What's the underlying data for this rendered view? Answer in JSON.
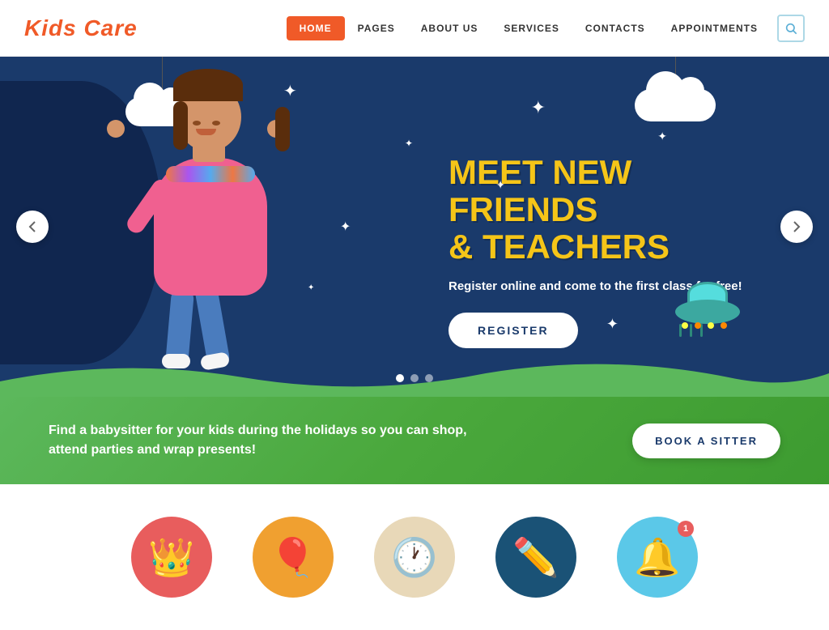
{
  "header": {
    "logo": "Kids Care",
    "nav": [
      {
        "label": "HOME",
        "active": true
      },
      {
        "label": "PAGES",
        "active": false
      },
      {
        "label": "ABOUT US",
        "active": false
      },
      {
        "label": "SERVICES",
        "active": false
      },
      {
        "label": "CONTACTS",
        "active": false
      },
      {
        "label": "APPOINTMENTS",
        "active": false
      }
    ],
    "search_icon": "🔍"
  },
  "hero": {
    "title_line1": "MEET NEW FRIENDS",
    "title_line2": "& TEACHERS",
    "subtitle": "Register online and come to the first class for free!",
    "register_btn": "REGISTER",
    "arrow_left": "❮",
    "arrow_right": "❯",
    "dots": [
      true,
      false,
      false
    ]
  },
  "green_band": {
    "text": "Find a babysitter for your kids during the holidays so you can shop,\nattend parties and wrap presents!",
    "button": "BOOK A SITTER"
  },
  "icons": [
    {
      "type": "crown",
      "color": "red",
      "symbol": "👑",
      "badge": null
    },
    {
      "type": "balloon",
      "color": "orange",
      "symbol": "🎈",
      "badge": null
    },
    {
      "type": "clock",
      "color": "beige",
      "symbol": "🕐",
      "badge": null
    },
    {
      "type": "pencil",
      "color": "navy",
      "symbol": "✏️",
      "badge": null
    },
    {
      "type": "bell",
      "color": "lightblue",
      "symbol": "🔔",
      "badge": "1"
    }
  ],
  "colors": {
    "primary_orange": "#f05a28",
    "hero_bg": "#1a3a6b",
    "yellow_text": "#f5c518",
    "green_band": "#4aa83c",
    "white": "#ffffff"
  }
}
